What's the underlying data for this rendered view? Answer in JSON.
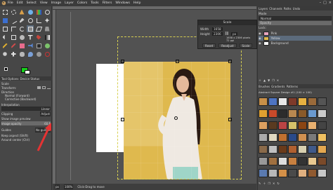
{
  "menubar": {
    "items": [
      "File",
      "Edit",
      "Select",
      "View",
      "Image",
      "Layer",
      "Colors",
      "Tools",
      "Filters",
      "Windows",
      "Help"
    ],
    "window_controls": [
      "–",
      "□",
      "×"
    ]
  },
  "tool_options": {
    "tabs": [
      "Tool Options",
      "Device Status"
    ],
    "tool_name": "Scale",
    "transform_label": "Transform:",
    "direction_label": "Direction",
    "direction_options": [
      "Normal (Forward)",
      "Corrective (Backward)"
    ],
    "interpolation_label": "Interpolation",
    "interpolation_value": "Linear",
    "clipping_label": "Clipping",
    "clipping_value": "Adjust",
    "show_preview_label": "Show image preview",
    "image_opacity_label": "Image opacity",
    "image_opacity_value": "60.6",
    "guides_label": "Guides",
    "guides_value": "No guides",
    "keep_aspect_label": "Keep aspect (Shift)",
    "around_center_label": "Around center (Ctrl)"
  },
  "scale_dialog": {
    "title": "Scale",
    "width_label": "Width",
    "width_value": "1658",
    "height_label": "Height",
    "height_value": "2306",
    "unit": "px",
    "resolution_line": "1658 x 2306 pixels",
    "ppi_line": "72 ppi",
    "buttons": [
      "Reset",
      "Readjust",
      "Scale"
    ]
  },
  "statusbar": {
    "unit": "px",
    "zoom": "100%",
    "message": "Click-Drag to move"
  },
  "right_dock": {
    "tabs": [
      "Layers",
      "Channels",
      "Paths",
      "Undo"
    ],
    "mode_label": "Mode",
    "mode_value": "Normal",
    "opacity_label": "Opacity",
    "lock_label": "Lock:",
    "layers": [
      {
        "name": "Pink",
        "color": "#e8a6c0"
      },
      {
        "name": "Yellow",
        "color": "#dfb94e"
      },
      {
        "name": "Background",
        "color": "#ffffff"
      }
    ],
    "brush_tabs": [
      "Brushes",
      "Gradients",
      "Patterns"
    ],
    "brush_set_label": "Abstract Square Design #1 (100 × 100)"
  },
  "colors": {
    "foreground": "#17d21b",
    "background": "#ffffff",
    "accent_highlight": "#e53333",
    "canvas_yellow": "#dfb94e"
  }
}
